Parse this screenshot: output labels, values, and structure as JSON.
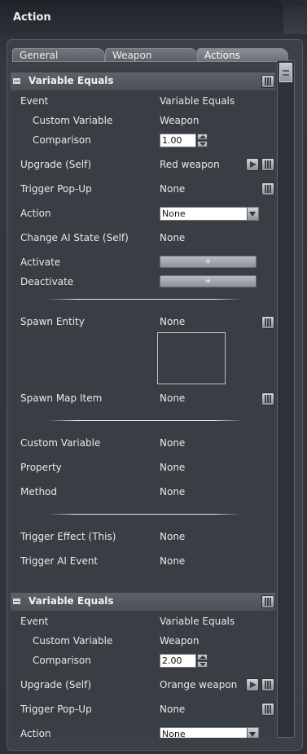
{
  "window": {
    "title": "Action"
  },
  "tabs": [
    {
      "label": "General"
    },
    {
      "label": "Weapon"
    },
    {
      "label": "Actions"
    }
  ],
  "sections": [
    {
      "title": "Variable Equals",
      "event_label": "Event",
      "event_value": "Variable Equals",
      "custom_variable_label": "Custom Variable",
      "custom_variable_value": "Weapon",
      "comparison_label": "Comparison",
      "comparison_value": "1.00",
      "upgrade_label": "Upgrade (Self)",
      "upgrade_value": "Red weapon",
      "trigger_popup_label": "Trigger Pop-Up",
      "trigger_popup_value": "None",
      "action_label": "Action",
      "action_value": "None",
      "change_ai_label": "Change AI State (Self)",
      "change_ai_value": "None",
      "activate_label": "Activate",
      "activate_button": "+",
      "deactivate_label": "Deactivate",
      "deactivate_button": "+",
      "spawn_entity_label": "Spawn Entity",
      "spawn_entity_value": "None",
      "spawn_map_item_label": "Spawn Map Item",
      "spawn_map_item_value": "None",
      "custom_variable2_label": "Custom Variable",
      "custom_variable2_value": "None",
      "property_label": "Property",
      "property_value": "None",
      "method_label": "Method",
      "method_value": "None",
      "trigger_effect_label": "Trigger Effect (This)",
      "trigger_effect_value": "None",
      "trigger_ai_event_label": "Trigger AI Event",
      "trigger_ai_event_value": "None"
    },
    {
      "title": "Variable Equals",
      "event_label": "Event",
      "event_value": "Variable Equals",
      "custom_variable_label": "Custom Variable",
      "custom_variable_value": "Weapon",
      "comparison_label": "Comparison",
      "comparison_value": "2.00",
      "upgrade_label": "Upgrade (Self)",
      "upgrade_value": "Orange weapon",
      "trigger_popup_label": "Trigger Pop-Up",
      "trigger_popup_value": "None",
      "action_label": "Action",
      "action_value": "None"
    }
  ]
}
